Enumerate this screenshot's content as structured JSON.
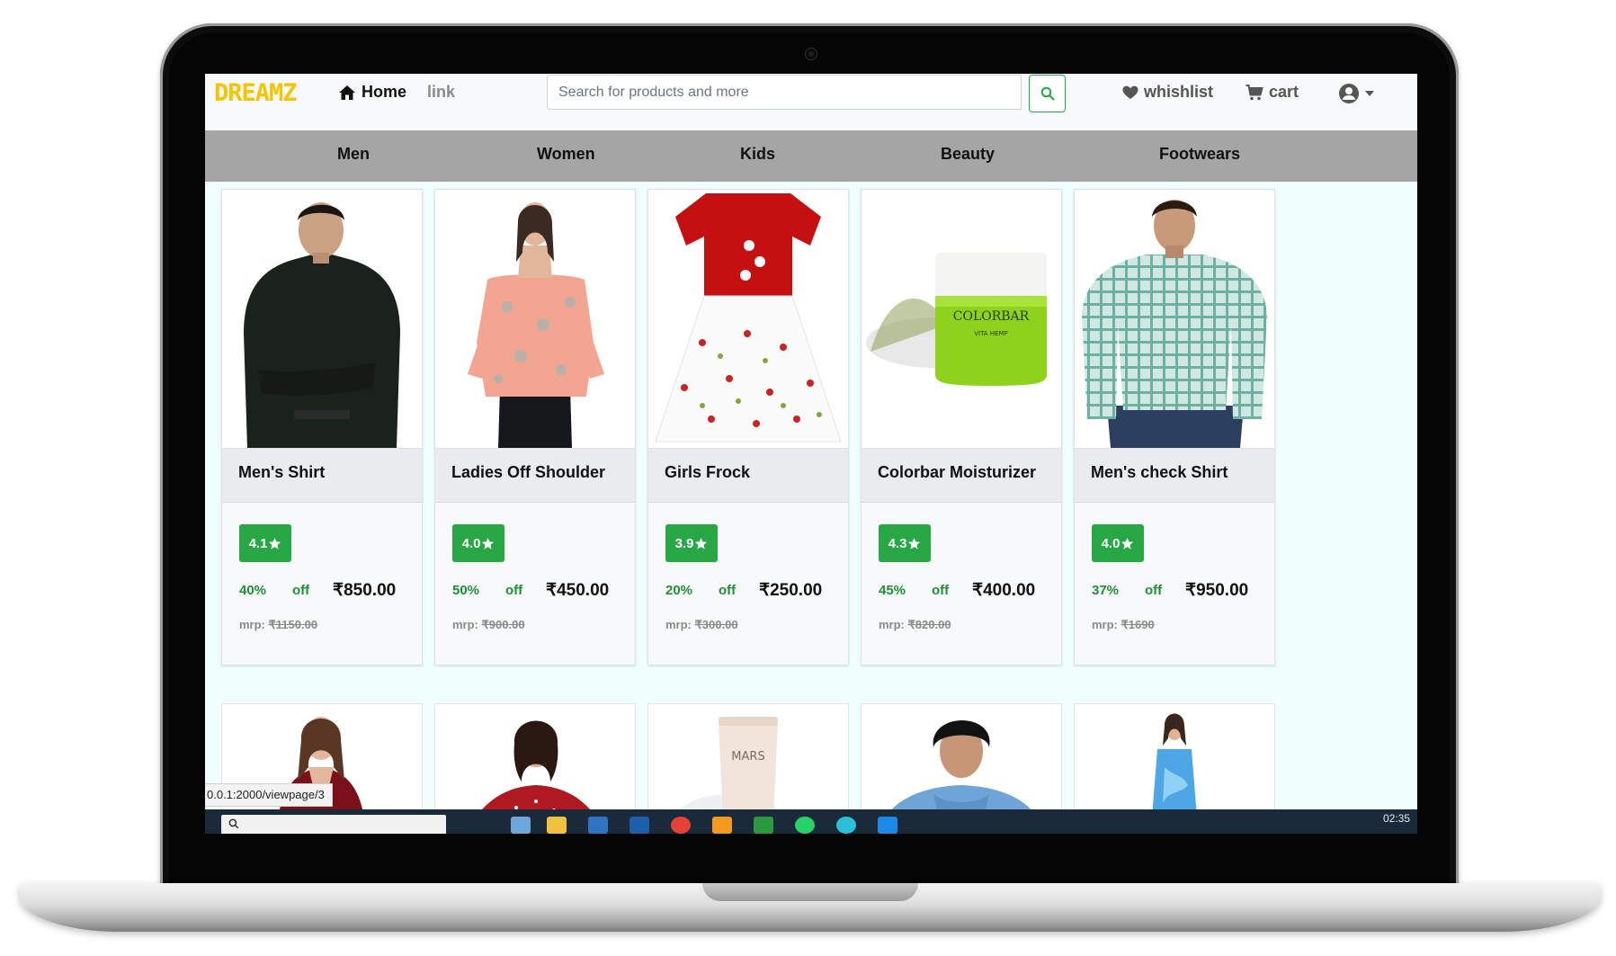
{
  "brand": "DREAMZ",
  "nav": {
    "home": "Home",
    "link": "link",
    "wishlist": "whishlist",
    "cart": "cart"
  },
  "search": {
    "placeholder": "Search for products and more"
  },
  "categories": [
    "Men",
    "Women",
    "Kids",
    "Beauty",
    "Footwears"
  ],
  "products": [
    {
      "name": "Men's Shirt",
      "rating": "4.1",
      "discount": "40%",
      "off": "off",
      "price": "₹850.00",
      "mrp_label": "mrp:",
      "mrp": "₹1150.00"
    },
    {
      "name": "Ladies Off Shoulder",
      "rating": "4.0",
      "discount": "50%",
      "off": "off",
      "price": "₹450.00",
      "mrp_label": "mrp:",
      "mrp": "₹900.00"
    },
    {
      "name": "Girls Frock",
      "rating": "3.9",
      "discount": "20%",
      "off": "off",
      "price": "₹250.00",
      "mrp_label": "mrp:",
      "mrp": "₹300.00"
    },
    {
      "name": "Colorbar Moisturizer",
      "rating": "4.3",
      "discount": "45%",
      "off": "off",
      "price": "₹400.00",
      "mrp_label": "mrp:",
      "mrp": "₹820.00"
    },
    {
      "name": "Men's check Shirt",
      "rating": "4.0",
      "discount": "37%",
      "off": "off",
      "price": "₹950.00",
      "mrp_label": "mrp:",
      "mrp": "₹1690"
    }
  ],
  "product_image_text": {
    "colorbar_brand": "COLORBAR",
    "colorbar_line": "VITA HEMP",
    "mars_brand": "MARS"
  },
  "status_url": "0.0.1:2000/viewpage/3",
  "taskbar": {
    "clock": "02:35"
  },
  "colors": {
    "brand": "#f5c400",
    "rating_bg": "#28a745",
    "category_bar": "#a5a5a5",
    "page_bg": "#f1ffff"
  }
}
